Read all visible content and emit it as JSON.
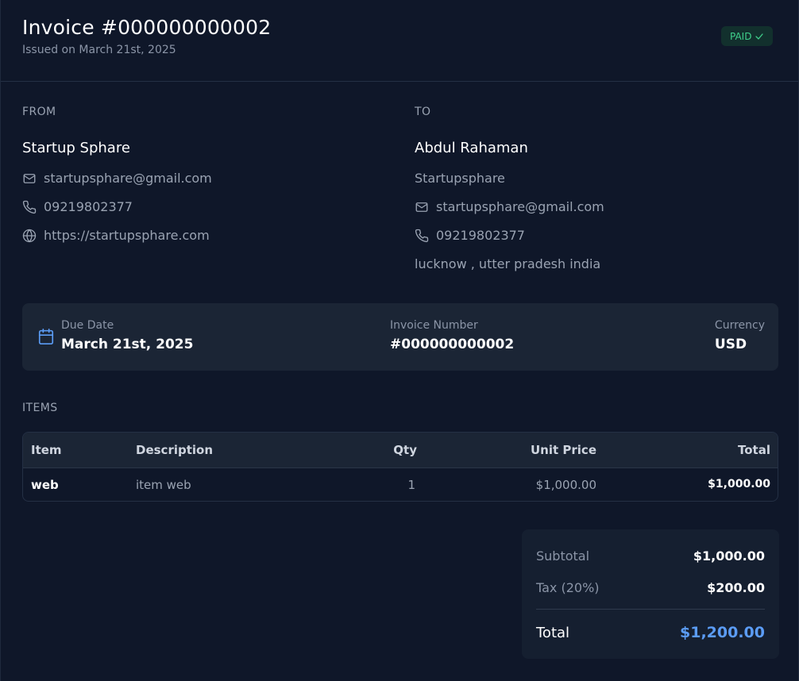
{
  "header": {
    "title": "Invoice #000000000002",
    "issued": "Issued on March 21st, 2025",
    "status": "PAID"
  },
  "from": {
    "label": "FROM",
    "name": "Startup Sphare",
    "email": "startupsphare@gmail.com",
    "phone": "09219802377",
    "website": "https://startupsphare.com"
  },
  "to": {
    "label": "TO",
    "name": "Abdul Rahaman",
    "company": "Startupsphare",
    "email": "startupsphare@gmail.com",
    "phone": "09219802377",
    "address": "lucknow , utter pradesh india"
  },
  "meta": {
    "due_label": "Due Date",
    "due_value": "March 21st, 2025",
    "number_label": "Invoice Number",
    "number_value": "#000000000002",
    "currency_label": "Currency",
    "currency_value": "USD"
  },
  "items": {
    "label": "ITEMS",
    "columns": [
      "Item",
      "Description",
      "Qty",
      "Unit Price",
      "Total"
    ],
    "rows": [
      {
        "item": "web",
        "description": "item web",
        "qty": "1",
        "unit_price": "$1,000.00",
        "total": "$1,000.00"
      }
    ]
  },
  "totals": {
    "subtotal_label": "Subtotal",
    "subtotal_value": "$1,000.00",
    "tax_label": "Tax (20%)",
    "tax_value": "$200.00",
    "total_label": "Total",
    "total_value": "$1,200.00"
  },
  "colors": {
    "background": "#0f1729",
    "card": "#1b2535",
    "paid": "#3fd08c",
    "accent": "#5b9cf5"
  }
}
